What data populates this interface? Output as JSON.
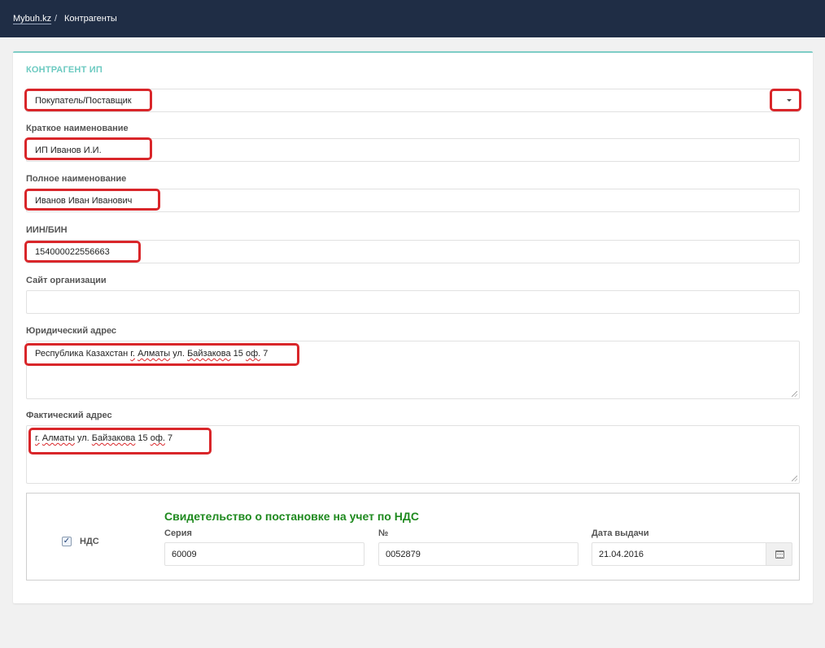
{
  "breadcrumb": {
    "home": "Mybuh.kz",
    "separator": "/",
    "current": "Контрагенты"
  },
  "card": {
    "title": "КОНТРАГЕНТ ИП"
  },
  "type_select": {
    "value": "Покупатель/Поставщик"
  },
  "fields": {
    "short_name": {
      "label": "Краткое наименование",
      "value": "ИП Иванов И.И."
    },
    "full_name": {
      "label": "Полное наименование",
      "value": "Иванов Иван Иванович"
    },
    "iin": {
      "label": "ИИН/БИН",
      "value": "154000022556663"
    },
    "website": {
      "label": "Сайт организации",
      "value": ""
    },
    "legal_address": {
      "label": "Юридический адрес",
      "parts": [
        "Республика Казахстан ",
        "г.",
        " ",
        "Алматы",
        "  ул. ",
        "Байзакова",
        " 15 ",
        "оф.",
        " 7"
      ]
    },
    "actual_address": {
      "label": "Фактический адрес",
      "parts": [
        "г.",
        " ",
        "Алматы",
        "  ул. ",
        "Байзакова",
        " 15 ",
        "оф.",
        " 7"
      ]
    }
  },
  "vat": {
    "checkbox_label": "НДС",
    "checked": true,
    "title": "Свидетельство о постановке на учет по НДС",
    "series": {
      "label": "Серия",
      "value": "60009"
    },
    "number": {
      "label": "№",
      "value": "0052879"
    },
    "date": {
      "label": "Дата выдачи",
      "value": "21.04.2016"
    }
  },
  "colors": {
    "topbar": "#1f2d45",
    "accent": "#6ccac1",
    "highlight": "#d9262a",
    "vat_title": "#1f8a1f"
  }
}
